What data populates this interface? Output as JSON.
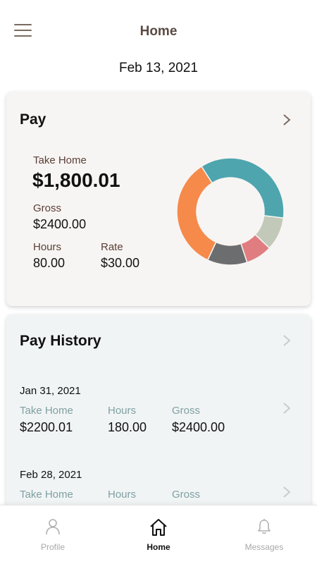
{
  "header": {
    "title": "Home",
    "menu_icon": "hamburger-menu-icon"
  },
  "date": "Feb 13, 2021",
  "pay": {
    "title": "Pay",
    "take_home_label": "Take Home",
    "take_home_value": "$1,800.01",
    "gross_label": "Gross",
    "gross_value": "$2400.00",
    "hours_label": "Hours",
    "hours_value": "80.00",
    "rate_label": "Rate",
    "rate_value": "$30.00",
    "donut": {
      "segments": [
        {
          "color": "#f68a4b",
          "fraction": 0.34
        },
        {
          "color": "#4ea5ae",
          "fraction": 0.36
        },
        {
          "color": "#c2c9b8",
          "fraction": 0.1
        },
        {
          "color": "#e07d80",
          "fraction": 0.08
        },
        {
          "color": "#6b6d6f",
          "fraction": 0.12
        }
      ]
    }
  },
  "history": {
    "title": "Pay History",
    "rows": [
      {
        "date": "Jan 31, 2021",
        "take_home_label": "Take Home",
        "take_home_value": "$2200.01",
        "hours_label": "Hours",
        "hours_value": "180.00",
        "gross_label": "Gross",
        "gross_value": "$2400.00"
      },
      {
        "date": "Feb 28, 2021",
        "take_home_label": "Take Home",
        "take_home_value": "",
        "hours_label": "Hours",
        "hours_value": "",
        "gross_label": "Gross",
        "gross_value": ""
      }
    ]
  },
  "tabs": [
    {
      "label": "Profile",
      "icon": "person-icon",
      "active": false
    },
    {
      "label": "Home",
      "icon": "home-icon",
      "active": true
    },
    {
      "label": "Messages",
      "icon": "bell-icon",
      "active": false
    }
  ],
  "colors": {
    "accent_brown": "#5a4a42",
    "label_brown": "#5a3e36",
    "history_label": "#7fa0a2",
    "pay_card_bg": "#f7f5f3",
    "history_card_bg": "#f1f4f5"
  }
}
